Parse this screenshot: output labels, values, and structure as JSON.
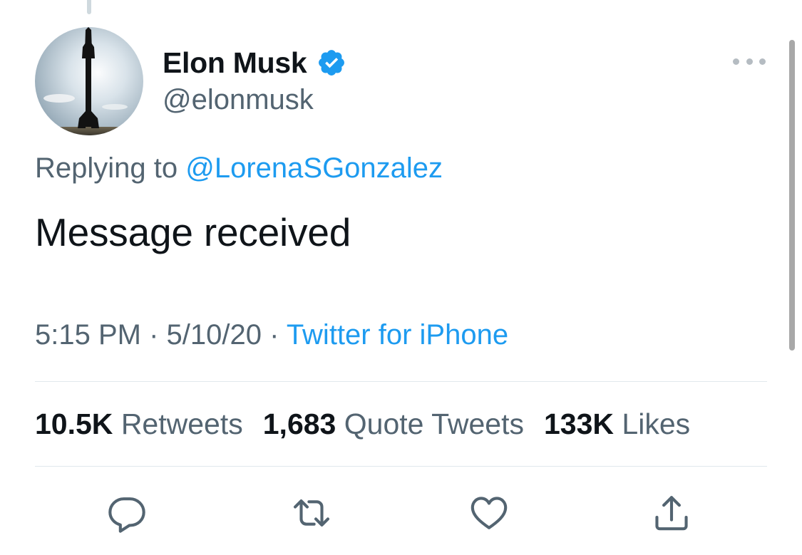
{
  "author": {
    "display_name": "Elon Musk",
    "handle": "@elonmusk",
    "verified": true,
    "avatar_icon": "starship-avatar-icon"
  },
  "reply": {
    "prefix": "Replying to ",
    "mention": "@LorenaSGonzalez"
  },
  "tweet": {
    "text": "Message received"
  },
  "meta": {
    "time": "5:15 PM",
    "separator": " · ",
    "date": "5/10/20",
    "source": "Twitter for iPhone"
  },
  "stats": {
    "retweets_count": "10.5K",
    "retweets_label": "Retweets",
    "quotes_count": "1,683",
    "quotes_label": "Quote Tweets",
    "likes_count": "133K",
    "likes_label": "Likes"
  },
  "actions": [
    "reply-icon",
    "retweet-icon",
    "like-icon",
    "share-icon"
  ],
  "colors": {
    "accent": "#1d9bf0",
    "text": "#0f1419",
    "muted": "#536471",
    "divider": "#e1e8ed"
  }
}
